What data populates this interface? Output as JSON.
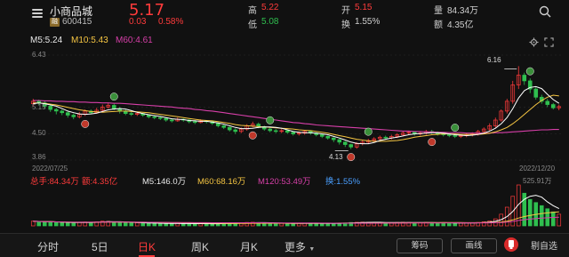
{
  "header": {
    "name": "小商品城",
    "badge": "融",
    "code": "600415",
    "price": "5.17",
    "change": "0.03",
    "change_pct": "0.58%",
    "high_label": "高",
    "high_value": "5.22",
    "low_label": "低",
    "low_value": "5.08",
    "open_label": "开",
    "open_value": "5.15",
    "turnover_label": "换",
    "turnover_value": "1.55%",
    "volume_label": "量",
    "volume_value": "84.34万",
    "amount_label": "额",
    "amount_value": "4.35亿"
  },
  "indicators": {
    "ma5": "M5:5.24",
    "ma10": "M10:5.43",
    "ma60": "M60:4.61"
  },
  "axis": {
    "y_top": "6.43",
    "y_2": "5.15",
    "y_3": "4.50",
    "y_bottom": "3.86",
    "date_start": "2022/07/25",
    "date_end": "2022/12/20",
    "marker_high": "6.16",
    "marker_low": "4.13",
    "vol_max": "525.91万"
  },
  "volume_row": {
    "total": "总手:84.34万",
    "amount": "额:4.35亿",
    "m5": "M5:146.0万",
    "m60": "M60:68.16万",
    "m120": "M120:53.49万",
    "turnover": "换:1.55%"
  },
  "tabs": [
    {
      "label": "分时",
      "active": false
    },
    {
      "label": "5日",
      "active": false
    },
    {
      "label": "日K",
      "active": true
    },
    {
      "label": "周K",
      "active": false
    },
    {
      "label": "月K",
      "active": false
    },
    {
      "label": "更多",
      "active": false
    }
  ],
  "tools": {
    "chip": "筹码",
    "draw": "画线",
    "notify": "剔自选"
  },
  "colors": {
    "up": "#ff3b3b",
    "down": "#2fbf4f",
    "ma5": "#ffffff",
    "ma10": "#f5c542",
    "ma60": "#d63fa8"
  },
  "chart_data": {
    "type": "candlestick",
    "ylim": [
      3.86,
      6.43
    ],
    "start_date": "2022/07/25",
    "end_date": "2022/12/20",
    "candles": [
      [
        5.24,
        5.3,
        5.36,
        5.18
      ],
      [
        5.3,
        5.26,
        5.34,
        5.2
      ],
      [
        5.26,
        5.18,
        5.3,
        5.12
      ],
      [
        5.18,
        5.1,
        5.22,
        5.04
      ],
      [
        5.1,
        5.06,
        5.14,
        4.98
      ],
      [
        5.06,
        5.02,
        5.1,
        4.96
      ],
      [
        5.02,
        4.96,
        5.06,
        4.9
      ],
      [
        4.96,
        4.92,
        5.0,
        4.86
      ],
      [
        4.92,
        4.98,
        5.04,
        4.88
      ],
      [
        4.98,
        5.06,
        5.1,
        4.94
      ],
      [
        5.06,
        5.02,
        5.1,
        4.98
      ],
      [
        5.02,
        5.08,
        5.14,
        5.0
      ],
      [
        5.08,
        5.16,
        5.22,
        5.04
      ],
      [
        5.16,
        5.2,
        5.26,
        5.12
      ],
      [
        5.2,
        5.12,
        5.24,
        5.08
      ],
      [
        5.12,
        5.06,
        5.16,
        5.0
      ],
      [
        5.06,
        5.0,
        5.1,
        4.96
      ],
      [
        5.0,
        4.98,
        5.04,
        4.94
      ],
      [
        4.98,
        5.0,
        5.04,
        4.94
      ],
      [
        5.0,
        4.96,
        5.02,
        4.92
      ],
      [
        4.96,
        4.92,
        4.98,
        4.88
      ],
      [
        4.92,
        4.9,
        4.96,
        4.86
      ],
      [
        4.9,
        4.88,
        4.94,
        4.84
      ],
      [
        4.88,
        4.84,
        4.9,
        4.8
      ],
      [
        4.84,
        4.82,
        4.88,
        4.78
      ],
      [
        4.82,
        4.86,
        4.9,
        4.8
      ],
      [
        4.86,
        4.84,
        4.88,
        4.8
      ],
      [
        4.84,
        4.8,
        4.86,
        4.76
      ],
      [
        4.8,
        4.78,
        4.84,
        4.74
      ],
      [
        4.78,
        4.82,
        4.86,
        4.76
      ],
      [
        4.82,
        4.8,
        4.84,
        4.76
      ],
      [
        4.8,
        4.76,
        4.82,
        4.72
      ],
      [
        4.76,
        4.7,
        4.78,
        4.66
      ],
      [
        4.7,
        4.66,
        4.72,
        4.62
      ],
      [
        4.66,
        4.6,
        4.68,
        4.56
      ],
      [
        4.6,
        4.56,
        4.64,
        4.5
      ],
      [
        4.56,
        4.62,
        4.66,
        4.52
      ],
      [
        4.62,
        4.7,
        4.74,
        4.58
      ],
      [
        4.7,
        4.74,
        4.8,
        4.66
      ],
      [
        4.74,
        4.68,
        4.78,
        4.64
      ],
      [
        4.68,
        4.62,
        4.7,
        4.58
      ],
      [
        4.62,
        4.58,
        4.66,
        4.54
      ],
      [
        4.58,
        4.56,
        4.62,
        4.52
      ],
      [
        4.56,
        4.58,
        4.62,
        4.52
      ],
      [
        4.58,
        4.54,
        4.6,
        4.5
      ],
      [
        4.54,
        4.5,
        4.56,
        4.46
      ],
      [
        4.5,
        4.52,
        4.56,
        4.46
      ],
      [
        4.52,
        4.56,
        4.6,
        4.48
      ],
      [
        4.56,
        4.52,
        4.58,
        4.48
      ],
      [
        4.52,
        4.48,
        4.54,
        4.44
      ],
      [
        4.48,
        4.44,
        4.5,
        4.4
      ],
      [
        4.44,
        4.4,
        4.46,
        4.36
      ],
      [
        4.4,
        4.36,
        4.42,
        4.3
      ],
      [
        4.36,
        4.3,
        4.38,
        4.24
      ],
      [
        4.3,
        4.24,
        4.32,
        4.18
      ],
      [
        4.24,
        4.18,
        4.26,
        4.13
      ],
      [
        4.18,
        4.26,
        4.3,
        4.14
      ],
      [
        4.26,
        4.3,
        4.34,
        4.22
      ],
      [
        4.3,
        4.34,
        4.38,
        4.26
      ],
      [
        4.34,
        4.38,
        4.42,
        4.3
      ],
      [
        4.38,
        4.42,
        4.46,
        4.34
      ],
      [
        4.42,
        4.4,
        4.46,
        4.36
      ],
      [
        4.4,
        4.44,
        4.48,
        4.36
      ],
      [
        4.44,
        4.48,
        4.52,
        4.4
      ],
      [
        4.48,
        4.52,
        4.56,
        4.44
      ],
      [
        4.52,
        4.54,
        4.58,
        4.48
      ],
      [
        4.54,
        4.5,
        4.56,
        4.46
      ],
      [
        4.5,
        4.52,
        4.56,
        4.46
      ],
      [
        4.52,
        4.56,
        4.6,
        4.48
      ],
      [
        4.56,
        4.54,
        4.6,
        4.5
      ],
      [
        4.54,
        4.5,
        4.56,
        4.46
      ],
      [
        4.5,
        4.48,
        4.52,
        4.44
      ],
      [
        4.48,
        4.46,
        4.5,
        4.42
      ],
      [
        4.46,
        4.44,
        4.48,
        4.4
      ],
      [
        4.44,
        4.46,
        4.5,
        4.4
      ],
      [
        4.46,
        4.48,
        4.52,
        4.42
      ],
      [
        4.48,
        4.5,
        4.54,
        4.44
      ],
      [
        4.5,
        4.56,
        4.6,
        4.46
      ],
      [
        4.56,
        4.62,
        4.66,
        4.52
      ],
      [
        4.62,
        4.7,
        4.76,
        4.58
      ],
      [
        4.7,
        4.84,
        4.9,
        4.66
      ],
      [
        4.84,
        5.06,
        5.1,
        4.8
      ],
      [
        5.06,
        5.3,
        5.36,
        5.0
      ],
      [
        5.3,
        5.7,
        5.8,
        5.24
      ],
      [
        5.7,
        5.94,
        6.16,
        5.6
      ],
      [
        5.94,
        5.8,
        6.0,
        5.7
      ],
      [
        5.8,
        5.6,
        5.86,
        5.5
      ],
      [
        5.6,
        5.4,
        5.66,
        5.34
      ],
      [
        5.4,
        5.3,
        5.46,
        5.24
      ],
      [
        5.3,
        5.22,
        5.36,
        5.16
      ],
      [
        5.22,
        5.14,
        5.26,
        5.1
      ],
      [
        5.14,
        5.17,
        5.22,
        5.08
      ]
    ],
    "ma5": [
      5.24,
      5.26,
      5.24,
      5.21,
      5.18,
      5.12,
      5.06,
      5.02,
      4.99,
      4.98,
      4.99,
      5.01,
      5.05,
      5.09,
      5.11,
      5.12,
      5.11,
      5.07,
      5.03,
      5.0,
      4.97,
      4.95,
      4.93,
      4.9,
      4.87,
      4.86,
      4.85,
      4.83,
      4.82,
      4.81,
      4.81,
      4.79,
      4.77,
      4.74,
      4.7,
      4.66,
      4.63,
      4.63,
      4.64,
      4.66,
      4.67,
      4.67,
      4.66,
      4.64,
      4.6,
      4.56,
      4.54,
      4.53,
      4.53,
      4.52,
      4.5,
      4.48,
      4.44,
      4.4,
      4.35,
      4.3,
      4.27,
      4.26,
      4.26,
      4.29,
      4.34,
      4.37,
      4.4,
      4.42,
      4.45,
      4.48,
      4.5,
      4.51,
      4.52,
      4.53,
      4.53,
      4.52,
      4.5,
      4.48,
      4.47,
      4.46,
      4.47,
      4.49,
      4.52,
      4.57,
      4.64,
      4.75,
      4.9,
      5.12,
      5.38,
      5.56,
      5.64,
      5.66,
      5.61,
      5.47,
      5.34,
      5.25
    ],
    "ma10": [
      5.26,
      5.26,
      5.25,
      5.23,
      5.21,
      5.18,
      5.15,
      5.12,
      5.09,
      5.07,
      5.05,
      5.04,
      5.03,
      5.04,
      5.05,
      5.06,
      5.06,
      5.05,
      5.04,
      5.03,
      5.02,
      5.0,
      4.98,
      4.96,
      4.94,
      4.92,
      4.9,
      4.88,
      4.86,
      4.84,
      4.83,
      4.82,
      4.8,
      4.78,
      4.76,
      4.73,
      4.71,
      4.7,
      4.69,
      4.68,
      4.67,
      4.66,
      4.65,
      4.64,
      4.63,
      4.62,
      4.6,
      4.59,
      4.58,
      4.56,
      4.54,
      4.52,
      4.49,
      4.46,
      4.43,
      4.4,
      4.37,
      4.35,
      4.33,
      4.32,
      4.32,
      4.32,
      4.33,
      4.34,
      4.36,
      4.39,
      4.42,
      4.44,
      4.46,
      4.48,
      4.49,
      4.5,
      4.5,
      4.5,
      4.49,
      4.49,
      4.49,
      4.49,
      4.5,
      4.52,
      4.55,
      4.6,
      4.66,
      4.75,
      4.86,
      4.98,
      5.1,
      5.22,
      5.32,
      5.4,
      5.45,
      5.43
    ],
    "ma60": [
      5.32,
      5.32,
      5.31,
      5.31,
      5.3,
      5.3,
      5.29,
      5.29,
      5.28,
      5.28,
      5.27,
      5.27,
      5.26,
      5.26,
      5.25,
      5.25,
      5.24,
      5.23,
      5.22,
      5.21,
      5.2,
      5.19,
      5.18,
      5.17,
      5.16,
      5.14,
      5.13,
      5.12,
      5.1,
      5.09,
      5.07,
      5.06,
      5.04,
      5.02,
      5.0,
      4.98,
      4.96,
      4.94,
      4.92,
      4.9,
      4.88,
      4.86,
      4.84,
      4.82,
      4.8,
      4.78,
      4.77,
      4.75,
      4.74,
      4.72,
      4.71,
      4.7,
      4.69,
      4.68,
      4.67,
      4.66,
      4.65,
      4.64,
      4.63,
      4.62,
      4.61,
      4.6,
      4.59,
      4.58,
      4.57,
      4.57,
      4.56,
      4.56,
      4.55,
      4.55,
      4.54,
      4.54,
      4.53,
      4.53,
      4.53,
      4.52,
      4.52,
      4.52,
      4.52,
      4.52,
      4.53,
      4.53,
      4.54,
      4.55,
      4.56,
      4.57,
      4.58,
      4.59,
      4.6,
      4.6,
      4.61,
      4.61
    ],
    "volume": [
      60,
      55,
      50,
      48,
      45,
      42,
      40,
      38,
      44,
      50,
      46,
      52,
      60,
      58,
      48,
      44,
      40,
      38,
      40,
      36,
      34,
      32,
      30,
      30,
      28,
      32,
      30,
      28,
      26,
      30,
      28,
      26,
      30,
      32,
      34,
      36,
      40,
      44,
      46,
      40,
      36,
      34,
      32,
      34,
      32,
      30,
      32,
      34,
      32,
      30,
      30,
      32,
      34,
      36,
      38,
      44,
      46,
      48,
      46,
      44,
      42,
      40,
      42,
      44,
      46,
      44,
      40,
      42,
      44,
      42,
      40,
      38,
      36,
      34,
      36,
      38,
      40,
      44,
      52,
      64,
      90,
      150,
      240,
      380,
      526,
      420,
      340,
      300,
      260,
      220,
      180,
      150
    ],
    "vol_max": 525.91
  }
}
